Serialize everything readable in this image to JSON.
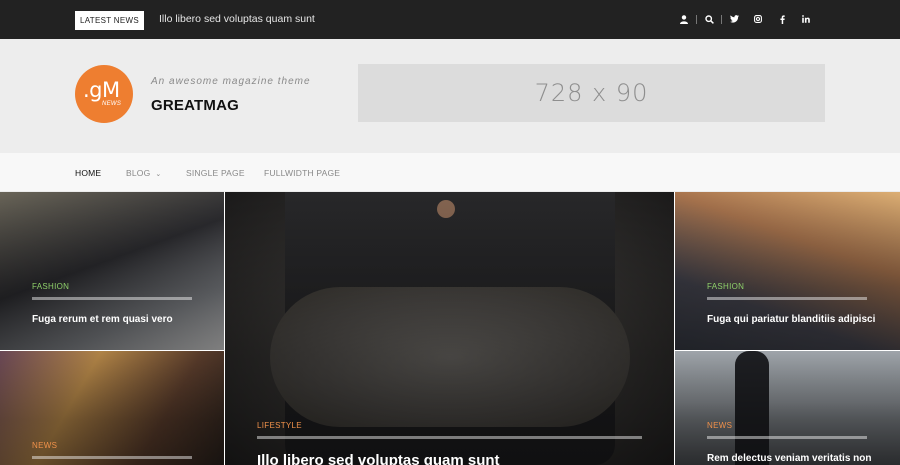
{
  "topbar": {
    "badge": "LATEST NEWS",
    "ticker": "Illo libero sed voluptas quam sunt",
    "icons": [
      "user-icon",
      "search-icon",
      "twitter-icon",
      "instagram-icon",
      "facebook-icon",
      "linkedin-icon"
    ]
  },
  "header": {
    "logo_main": ".gM",
    "logo_sub": "NEWS",
    "tagline": "An awesome magazine theme",
    "site_title": "GREATMAG",
    "ad_text": "728 x 90",
    "logo_color": "#ee7e30"
  },
  "nav": {
    "items": [
      {
        "label": "HOME"
      },
      {
        "label": "BLOG"
      },
      {
        "label": "SINGLE PAGE"
      },
      {
        "label": "FULLWIDTH PAGE"
      }
    ]
  },
  "featured": [
    {
      "category": "FASHION",
      "title": "Fuga rerum et rem quasi vero"
    },
    {
      "category": "NEWS",
      "title": ""
    },
    {
      "category": "LIFESTYLE",
      "title": "Illo libero sed voluptas quam sunt"
    },
    {
      "category": "FASHION",
      "title": "Fuga qui pariatur blanditiis adipisci"
    },
    {
      "category": "NEWS",
      "title": "Rem delectus veniam veritatis non"
    }
  ],
  "colors": {
    "topbar_bg": "#222222",
    "category_green": "#8fd16a",
    "category_orange": "#f0914a"
  }
}
